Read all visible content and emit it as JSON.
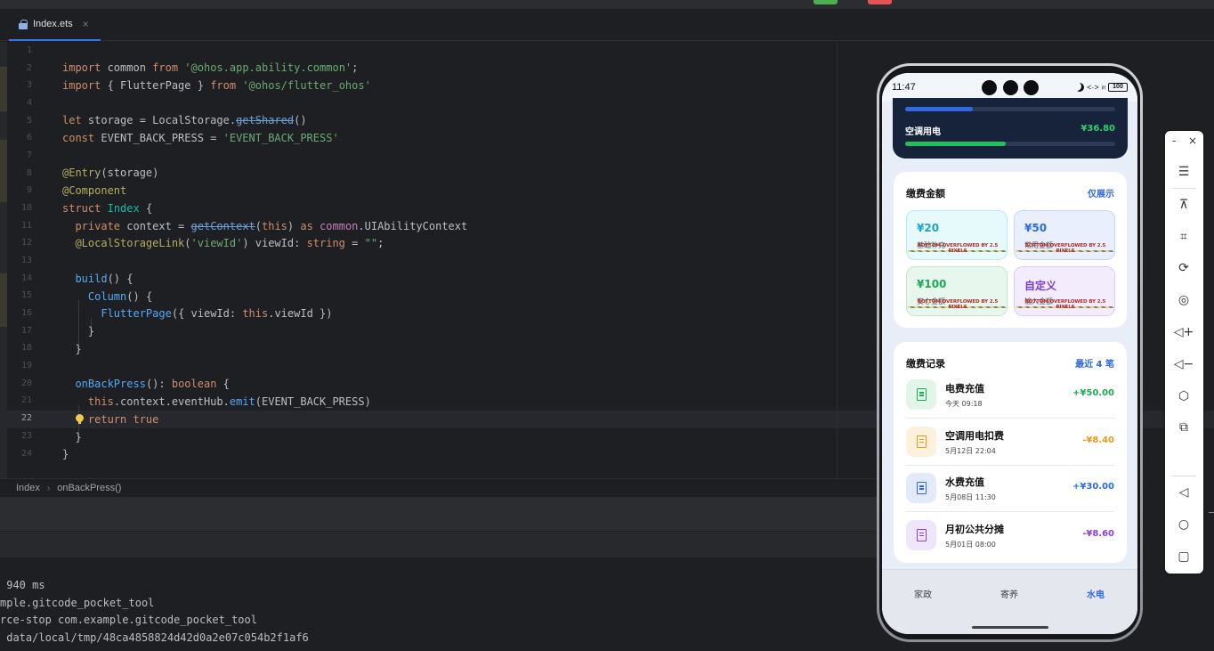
{
  "ide": {
    "tab": {
      "label": "Index.ets",
      "close": "×"
    },
    "breadcrumb": [
      "Index",
      "onBackPress()"
    ],
    "current_line": 22,
    "line_numbers": [
      "1",
      "2",
      "3",
      "4",
      "5",
      "6",
      "7",
      "8",
      "9",
      "10",
      "11",
      "12",
      "13",
      "14",
      "15",
      "16",
      "17",
      "18",
      "19",
      "20",
      "21",
      "22",
      "23",
      "24"
    ],
    "console_lines": [
      " 940 ms",
      "mple.gitcode_pocket_tool",
      "rce-stop com.example.gitcode_pocket_tool",
      " data/local/tmp/48ca4858824d42d0a2e07c054b2f1af6"
    ]
  },
  "phone": {
    "status": {
      "time": "11:47",
      "signal": "<·>",
      "battery": "100"
    },
    "top_card": {
      "label": "空调用电",
      "amount": "¥36.80",
      "bar1_fill_fraction": 0.32,
      "bar2_fill_fraction": 0.48,
      "bar1_color": "#2f6ae0",
      "bar2_color": "#22c05c"
    },
    "payment": {
      "title": "缴费金额",
      "link": "仅展示",
      "overflow_text": "BOTTOM OVERFLOWED BY 2.5 PIXELS",
      "tiles": [
        {
          "amount": "¥20",
          "sub": "基础补充",
          "color": "#1aa6c9",
          "bg": "#e6f9fb",
          "border": "#b9e9f2"
        },
        {
          "amount": "¥50",
          "sub": "常用金额",
          "color": "#2f6ae0",
          "bg": "#e9effd",
          "border": "#c5d5f7"
        },
        {
          "amount": "¥100",
          "sub": "安心金额",
          "color": "#1ea955",
          "bg": "#e7f7ed",
          "border": "#bfe8cd"
        },
        {
          "amount": "自定义",
          "sub": "输入金额",
          "color": "#7d3ddb",
          "bg": "#f3ecfd",
          "border": "#dcc9f7"
        }
      ]
    },
    "records": {
      "title": "缴费记录",
      "link": "最近 4 笔",
      "items": [
        {
          "title": "电费充值",
          "time": "今天 09:18",
          "amount": "+¥50.00",
          "color": "#1ea955",
          "bg": "#e2f5e9"
        },
        {
          "title": "空调用电扣费",
          "time": "5月12日 22:04",
          "amount": "-¥8.40",
          "color": "#e89a1a",
          "bg": "#fdf1dc"
        },
        {
          "title": "水费充值",
          "time": "5月08日 11:30",
          "amount": "+¥30.00",
          "color": "#2f6ae0",
          "bg": "#e3ebfb"
        },
        {
          "title": "月初公共分摊",
          "time": "5月01日 08:00",
          "amount": "-¥8.60",
          "color": "#8a3fdf",
          "bg": "#efe6fb"
        }
      ]
    },
    "nav": [
      {
        "label": "家政",
        "active": false
      },
      {
        "label": "寄养",
        "active": false
      },
      {
        "label": "水电",
        "active": true
      }
    ]
  },
  "toolbar": {
    "minimize": "-",
    "close": "×",
    "icons": [
      "menu-icon",
      "unpin-icon",
      "crop-icon",
      "rotate-icon",
      "screenshot-icon",
      "volume-up-icon",
      "volume-down-icon",
      "shake-icon",
      "multi-window-icon",
      "back-icon",
      "home-icon",
      "recents-icon"
    ]
  }
}
